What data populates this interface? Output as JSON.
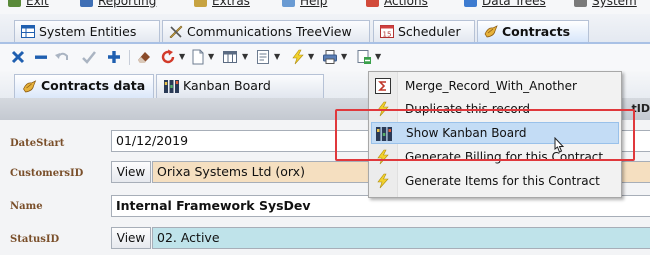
{
  "menubar": {
    "items": [
      "Exit",
      "Reporting",
      "Extras",
      "Help",
      "Actions",
      "Data Trees",
      "System"
    ]
  },
  "tabs": [
    {
      "label": "System Entities",
      "icon": "grid-icon"
    },
    {
      "label": "Communications TreeView",
      "icon": "tools-icon"
    },
    {
      "label": "Scheduler",
      "icon": "calendar-icon",
      "icon_text": "15"
    },
    {
      "label": "Contracts",
      "icon": "contracts-icon",
      "active": true
    }
  ],
  "subtabs": [
    {
      "label": "Contracts data",
      "icon": "contracts-icon",
      "active": true
    },
    {
      "label": "Kanban Board",
      "icon": "kanban-icon"
    }
  ],
  "form_header": {
    "column_id": "tID"
  },
  "form": {
    "view_label": "View",
    "fields": [
      {
        "label": "DateStart",
        "value": "01/12/2019",
        "has_view": false
      },
      {
        "label": "CustomersID",
        "value": "Orixa Systems Ltd (orx)",
        "has_view": true,
        "bg": "#f5dfc0"
      },
      {
        "label": "Name",
        "value": "Internal Framework SysDev",
        "has_view": false,
        "bold": true
      },
      {
        "label": "StatusID",
        "value": "02. Active",
        "has_view": true,
        "bg": "#bfe3ea"
      }
    ]
  },
  "context_menu": {
    "items": [
      {
        "label": "Merge_Record_With_Another",
        "icon": "sigma-icon"
      },
      {
        "label": "Duplicate this record",
        "icon": "lightning-icon"
      },
      {
        "label": "Show Kanban Board",
        "icon": "kanban-icon",
        "highlighted": true
      },
      {
        "label": "Generate Billing for this Contract",
        "icon": "lightning-icon"
      },
      {
        "label": "Generate Items for this Contract",
        "icon": "lightning-icon"
      }
    ]
  },
  "colors": {
    "highlight": "#c3dcf5",
    "callout_border": "#e0383c",
    "customers_field": "#f5dfc0",
    "status_field": "#bfe3ea",
    "label_text": "#7a4f2a"
  }
}
